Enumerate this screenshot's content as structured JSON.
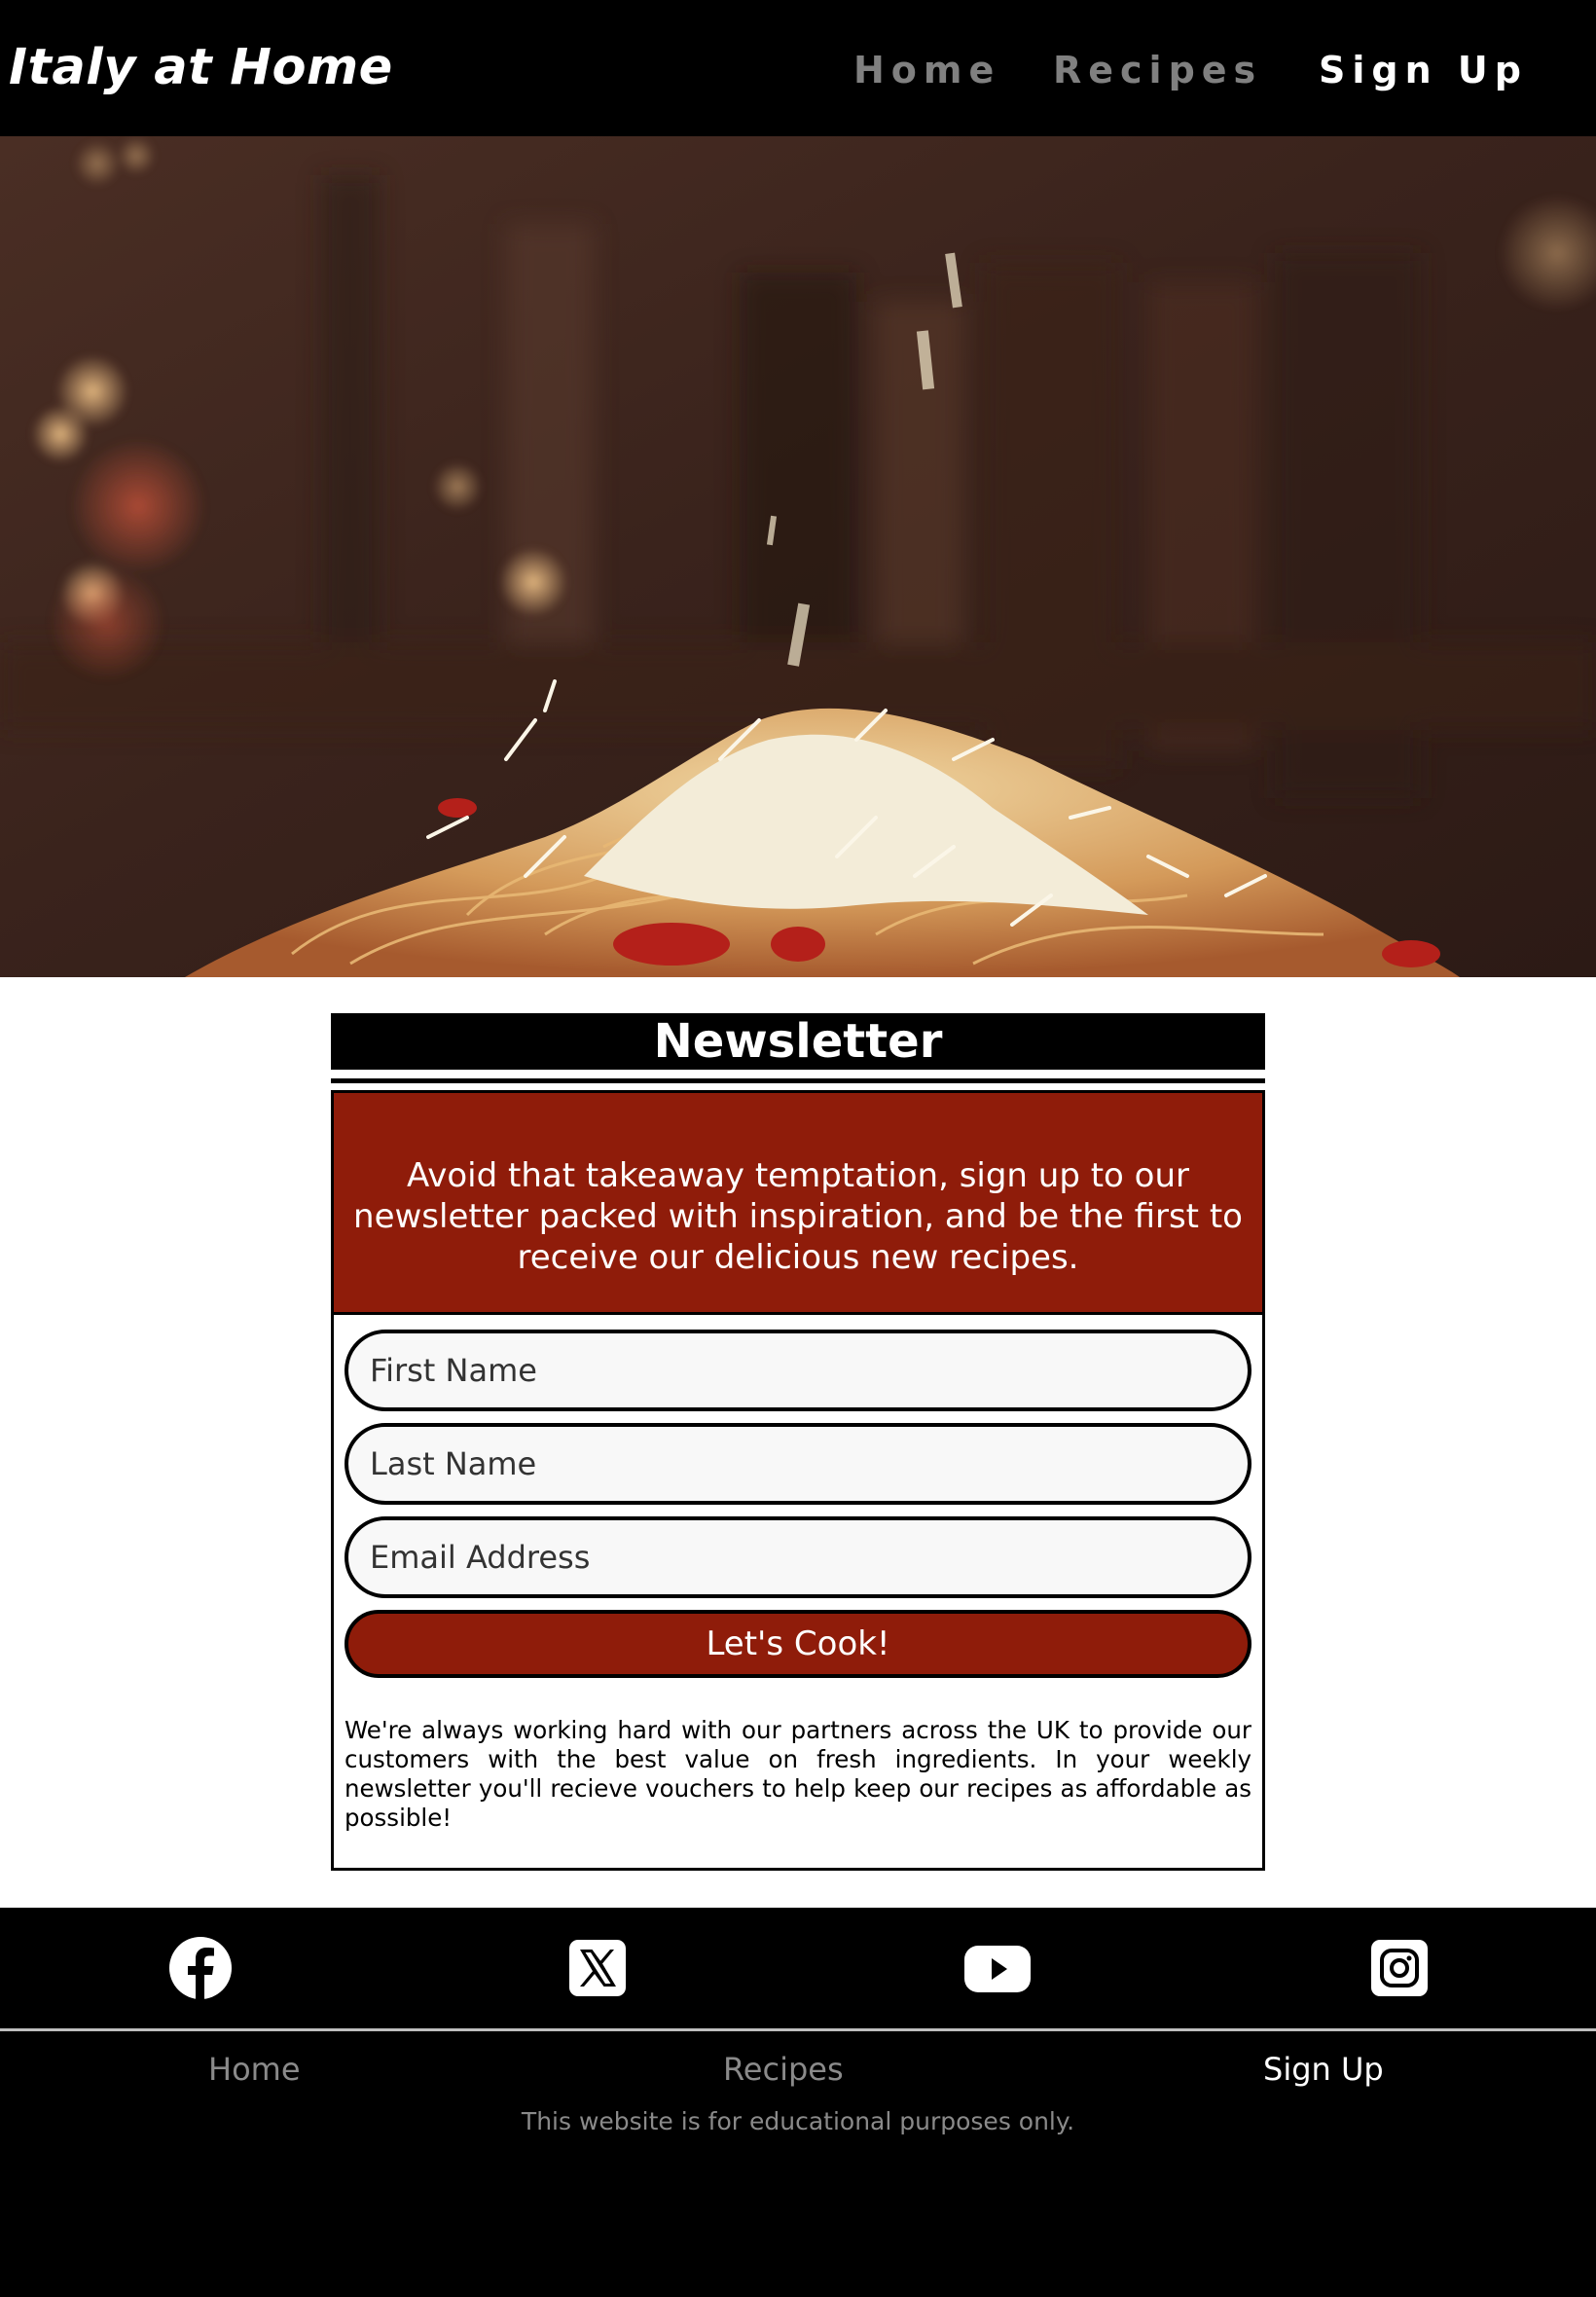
{
  "header": {
    "brand": "Italy at Home",
    "nav": [
      {
        "label": "Home"
      },
      {
        "label": "Recipes"
      },
      {
        "label": "Sign Up"
      }
    ],
    "active_nav": "Sign Up"
  },
  "hero": {
    "image_subject": "spaghetti-with-tomato-sauce-and-grated-parmesan"
  },
  "newsletter": {
    "title": "Newsletter",
    "intro": "Avoid that takeaway temptation, sign up to our newsletter packed with inspiration, and be the first to receive our delicious new recipes.",
    "fields": {
      "first_name": {
        "placeholder": "First Name",
        "value": ""
      },
      "last_name": {
        "placeholder": "Last Name",
        "value": ""
      },
      "email": {
        "placeholder": "Email Address",
        "value": ""
      }
    },
    "submit_label": "Let's Cook!",
    "note": "We're always working hard with our partners across the UK to provide our customers with the best value on fresh ingredients. In your weekly newsletter you'll recieve vouchers to help keep our recipes as affordable as possible!"
  },
  "footer": {
    "social": [
      {
        "icon": "facebook-icon"
      },
      {
        "icon": "x-twitter-icon"
      },
      {
        "icon": "youtube-icon"
      },
      {
        "icon": "instagram-icon"
      }
    ],
    "nav": [
      {
        "label": "Home"
      },
      {
        "label": "Recipes"
      },
      {
        "label": "Sign Up"
      }
    ],
    "disclaimer": "This website is for educational purposes only."
  },
  "colors": {
    "header_bg": "#000000",
    "accent_red": "#8f1c0a",
    "nav_inactive": "#808080",
    "nav_active": "#ffffff",
    "field_bg": "#f8f8f8"
  }
}
